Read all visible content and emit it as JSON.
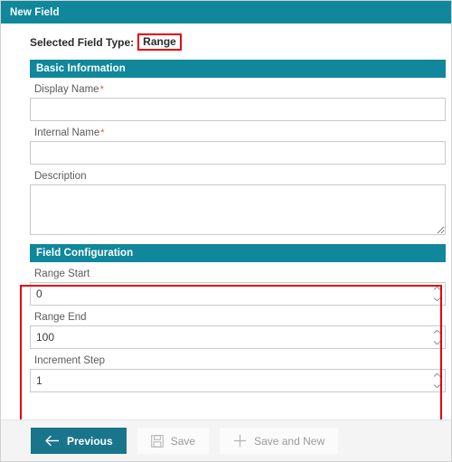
{
  "window": {
    "title": "New Field"
  },
  "selected_type": {
    "label": "Selected Field Type:",
    "value": "Range",
    "highlight_color": "#e8000b"
  },
  "sections": {
    "basic_information": {
      "header": "Basic Information",
      "fields": {
        "display_name": {
          "label": "Display Name",
          "required_marker": "*",
          "value": "",
          "placeholder": ""
        },
        "internal_name": {
          "label": "Internal Name",
          "required_marker": "*",
          "value": "",
          "placeholder": ""
        },
        "description": {
          "label": "Description",
          "value": "",
          "placeholder": ""
        }
      }
    },
    "field_configuration": {
      "header": "Field Configuration",
      "fields": {
        "range_start": {
          "label": "Range Start",
          "value": "0",
          "placeholder": ""
        },
        "range_end": {
          "label": "Range End",
          "value": "100",
          "placeholder": ""
        },
        "increment_step": {
          "label": "Increment Step",
          "value": "1",
          "placeholder": ""
        }
      }
    }
  },
  "footer": {
    "previous_label": "Previous",
    "save_label": "Save",
    "save_and_new_label": "Save and New"
  },
  "theme": {
    "teal": "#10879b",
    "primary_button": "#19758b",
    "annotation_red": "#e8000b",
    "label_gray": "#5b5b5b",
    "border_gray": "#c9c9c9"
  }
}
